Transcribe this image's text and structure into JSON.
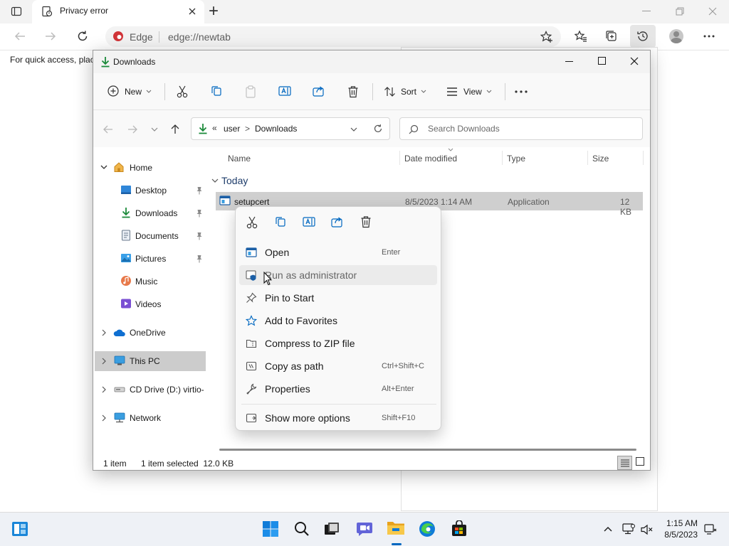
{
  "browser": {
    "tab_title": "Privacy error",
    "new_tab_symbol": "+",
    "edge_label": "Edge",
    "url": "edge://newtab",
    "quick_access": "For quick access, plac"
  },
  "explorer": {
    "title": "Downloads",
    "toolbar": {
      "new_label": "New",
      "sort_label": "Sort",
      "view_label": "View"
    },
    "breadcrumb": {
      "overflow": "«",
      "user": "user",
      "sep": ">",
      "downloads": "Downloads"
    },
    "search_placeholder": "Search Downloads",
    "columns": [
      "Name",
      "Date modified",
      "Type",
      "Size"
    ],
    "group_label": "Today",
    "file": {
      "name": "setupcert",
      "date": "8/5/2023 1:14 AM",
      "type": "Application",
      "size": "12 KB"
    },
    "nav": {
      "home": "Home",
      "desktop": "Desktop",
      "downloads": "Downloads",
      "documents": "Documents",
      "pictures": "Pictures",
      "music": "Music",
      "videos": "Videos",
      "onedrive": "OneDrive",
      "this_pc": "This PC",
      "cd_drive": "CD Drive (D:) virtio-",
      "network": "Network"
    },
    "status": {
      "count": "1 item",
      "selected": "1 item selected  12.0 KB"
    }
  },
  "context_menu": {
    "items": [
      {
        "label": "Open",
        "shortcut": "Enter"
      },
      {
        "label": "Run as administrator",
        "shortcut": ""
      },
      {
        "label": "Pin to Start",
        "shortcut": ""
      },
      {
        "label": "Add to Favorites",
        "shortcut": ""
      },
      {
        "label": "Compress to ZIP file",
        "shortcut": ""
      },
      {
        "label": "Copy as path",
        "shortcut": "Ctrl+Shift+C"
      },
      {
        "label": "Properties",
        "shortcut": "Alt+Enter"
      },
      {
        "label": "Show more options",
        "shortcut": "Shift+F10"
      }
    ]
  },
  "taskbar": {
    "time": "1:15 AM",
    "date": "8/5/2023"
  },
  "colors": {
    "accent": "#0067c0",
    "download_green": "#1b8a3a",
    "folder_yellow": "#e8b33a",
    "edge_red": "#d13438"
  }
}
